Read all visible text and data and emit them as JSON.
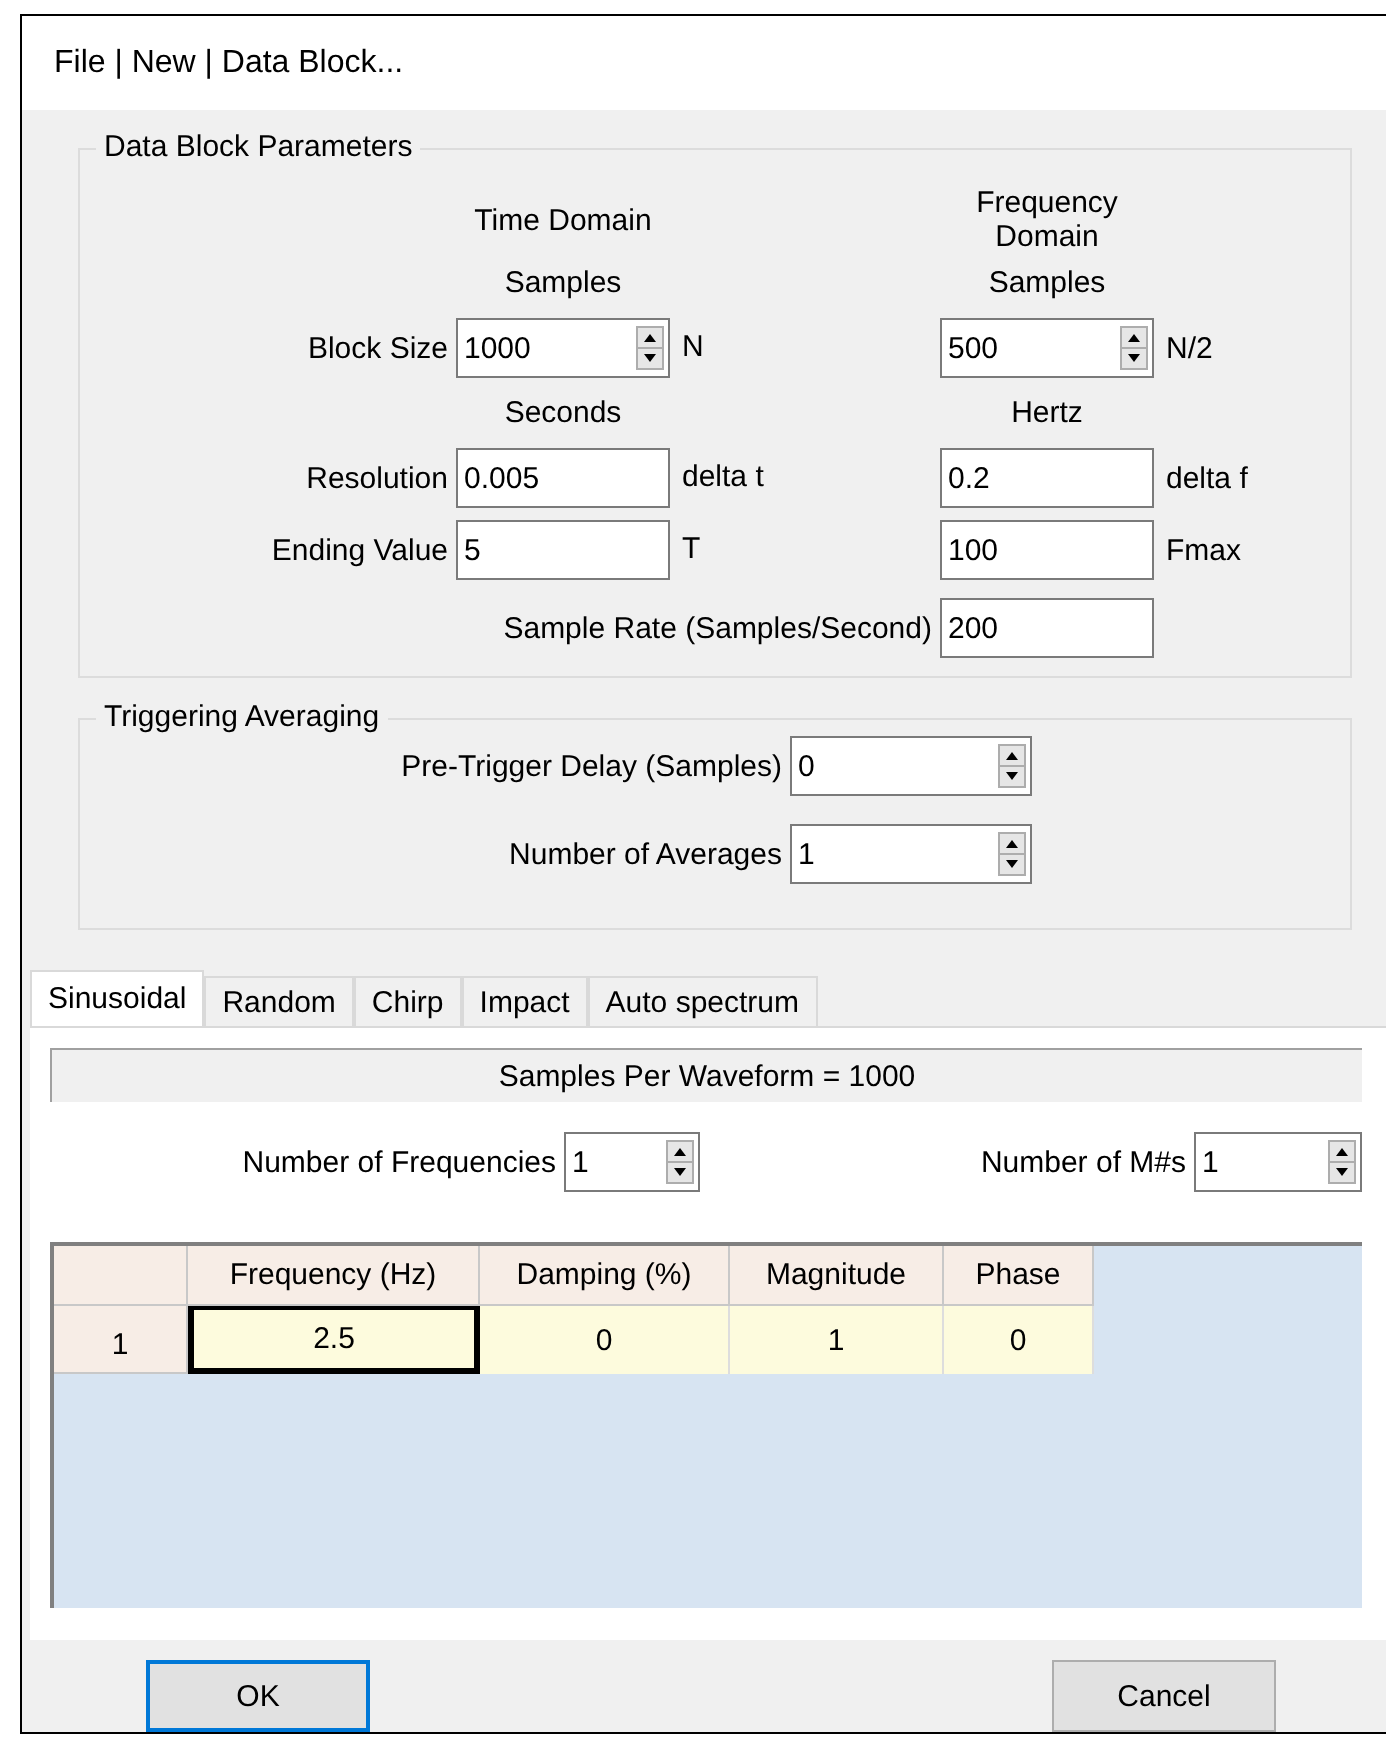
{
  "window": {
    "title": "File | New | Data Block..."
  },
  "data_block": {
    "title": "Data Block Parameters",
    "rows": [
      {
        "kind": "heading",
        "left": "Time Domain",
        "right": "Frequency Domain"
      },
      {
        "kind": "heading",
        "left": "Samples",
        "right": "Samples"
      },
      {
        "kind": "fields",
        "label": "Block Size",
        "left": {
          "kind": "spinner",
          "value": "1000",
          "unit": "N"
        },
        "right": {
          "kind": "spinner",
          "value": "500",
          "unit": "N/2"
        }
      },
      {
        "kind": "heading",
        "left": "Seconds",
        "right": "Hertz"
      },
      {
        "kind": "fields",
        "label": "Resolution",
        "left": {
          "kind": "text",
          "value": "0.005",
          "unit": "delta t"
        },
        "right": {
          "kind": "text",
          "value": "0.2",
          "unit": "delta f"
        }
      },
      {
        "kind": "fields",
        "label": "Ending Value",
        "left": {
          "kind": "text",
          "value": "5",
          "unit": "T"
        },
        "right": {
          "kind": "text",
          "value": "100",
          "unit": "Fmax"
        }
      },
      {
        "kind": "wide",
        "label": "Sample Rate (Samples/Second)",
        "value": "200"
      }
    ]
  },
  "triggering": {
    "title": "Triggering Averaging",
    "fields": [
      {
        "label": "Pre-Trigger Delay (Samples)",
        "value": "0"
      },
      {
        "label": "Number of Averages",
        "value": "1"
      }
    ]
  },
  "tabs": [
    {
      "label": "Sinusoidal",
      "selected": true
    },
    {
      "label": "Random",
      "selected": false
    },
    {
      "label": "Chirp",
      "selected": false
    },
    {
      "label": "Impact",
      "selected": false
    },
    {
      "label": "Auto spectrum",
      "selected": false
    }
  ],
  "waveform_info": "Samples Per Waveform = 1000",
  "counts": [
    {
      "label": "Number of Frequencies",
      "value": "1"
    },
    {
      "label": "Number of M#s",
      "value": "1"
    }
  ],
  "table": {
    "columns": [
      "Frequency (Hz)",
      "Damping (%)",
      "Magnitude",
      "Phase"
    ],
    "rows": [
      {
        "header": "1",
        "cells": [
          {
            "value": "2.5",
            "selected": true
          },
          {
            "value": "0",
            "selected": false
          },
          {
            "value": "1",
            "selected": false
          },
          {
            "value": "0",
            "selected": false
          }
        ]
      }
    ]
  },
  "buttons": [
    {
      "label": "OK",
      "default": true
    },
    {
      "label": "Cancel",
      "default": false
    }
  ]
}
